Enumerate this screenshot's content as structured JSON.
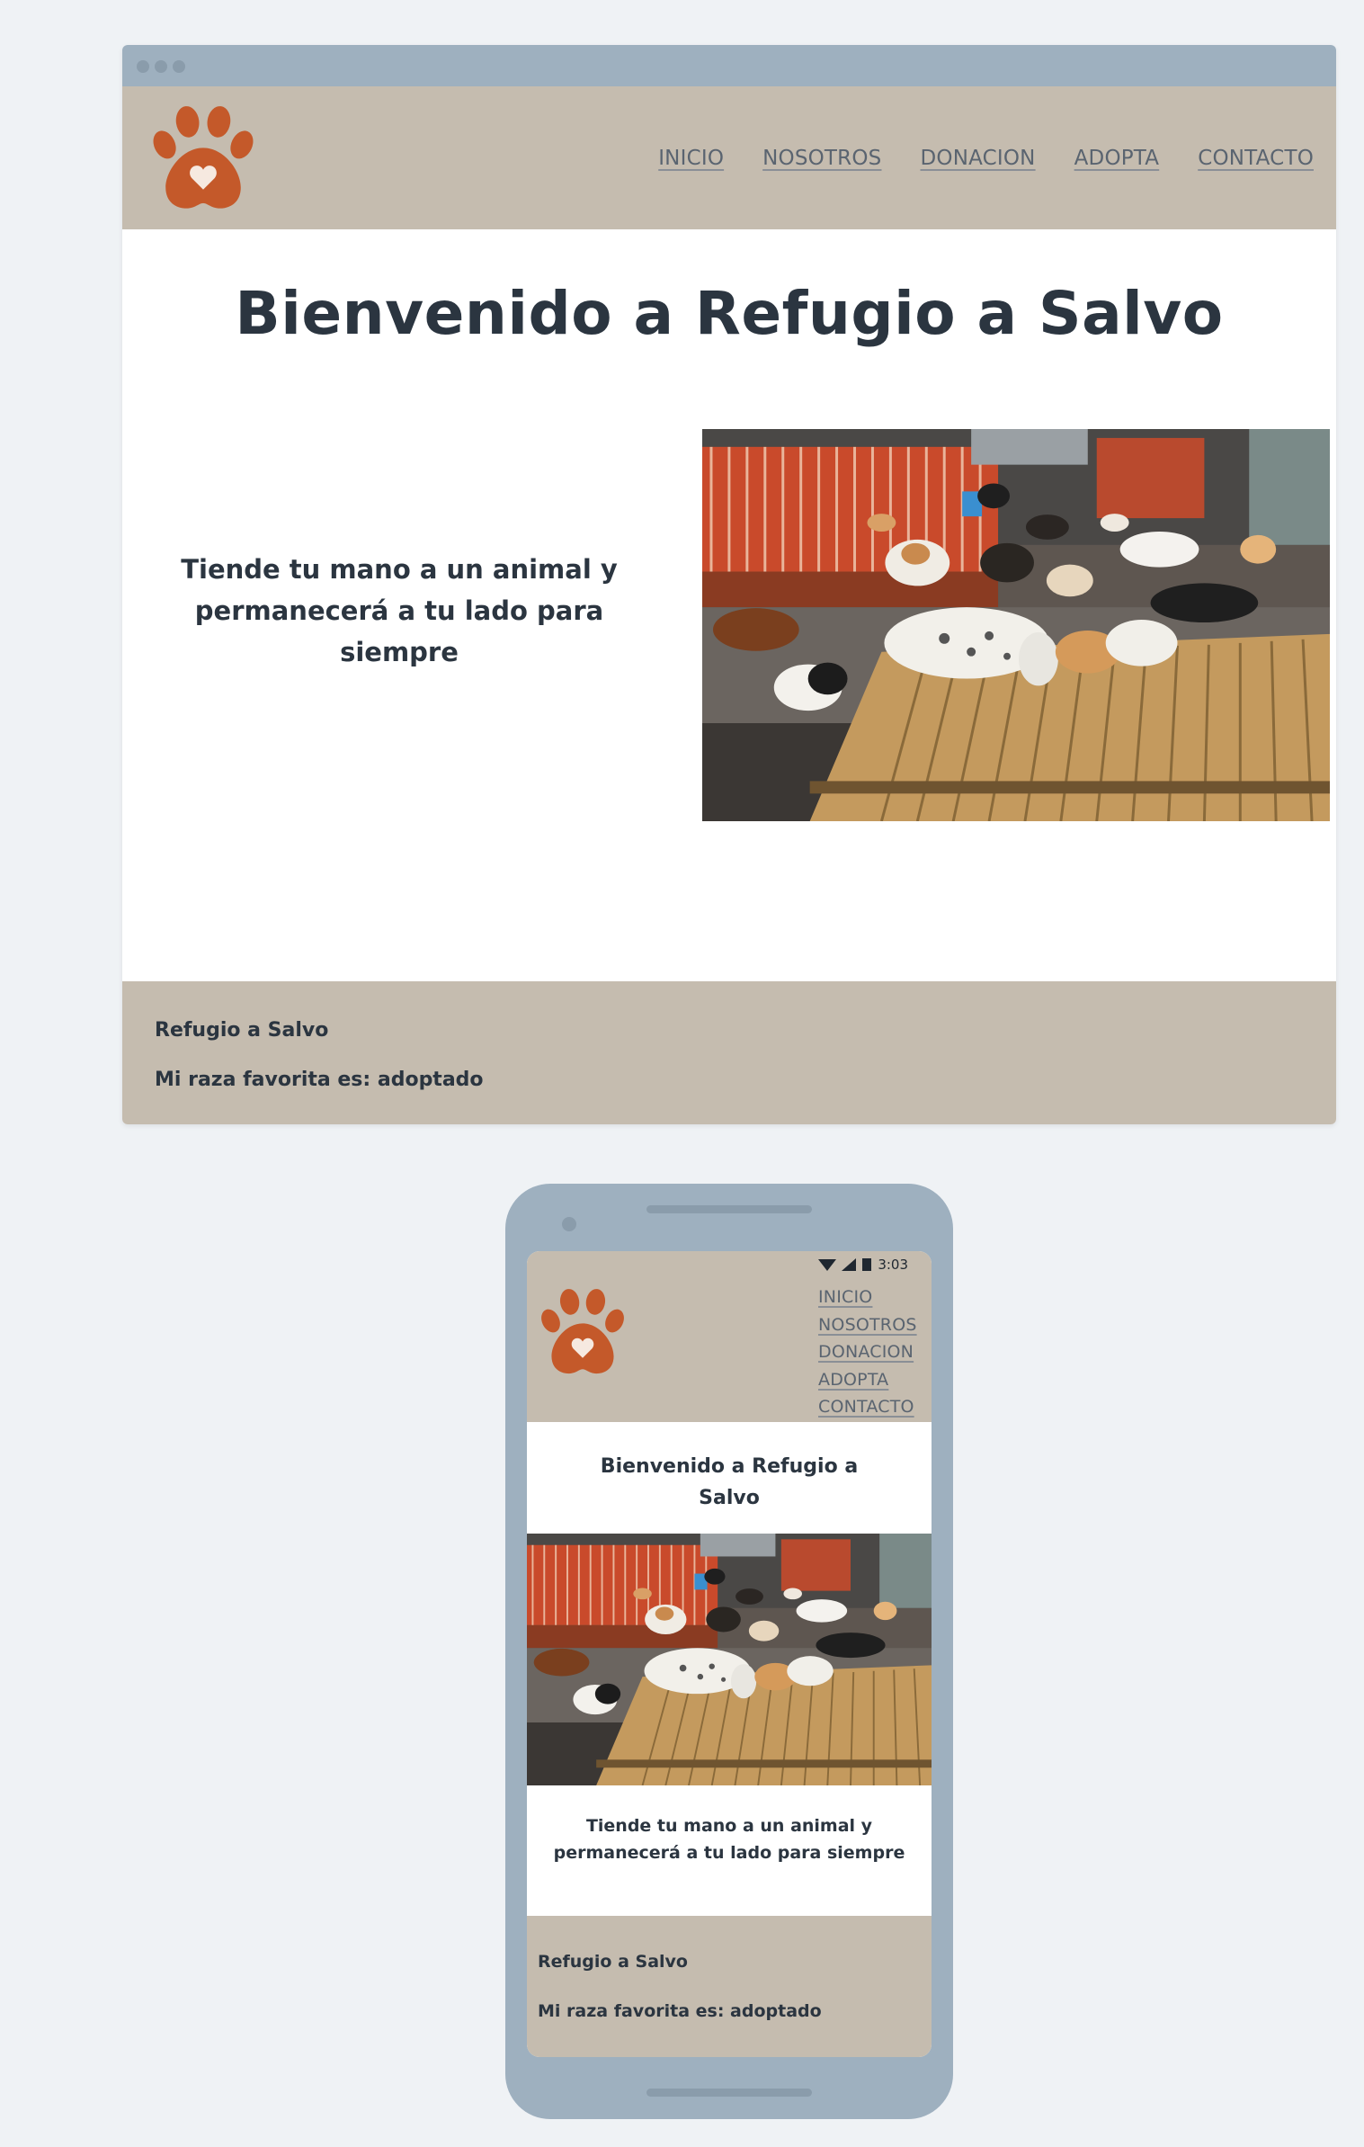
{
  "brand": {
    "logo_icon": "paw-heart-icon",
    "logo_color": "#c4592a",
    "header_bg": "#c5bcaf",
    "text_color": "#2b3540"
  },
  "nav": {
    "items": [
      {
        "label": "INICIO"
      },
      {
        "label": "NOSOTROS"
      },
      {
        "label": "DONACION"
      },
      {
        "label": "ADOPTA"
      },
      {
        "label": "CONTACTO"
      }
    ]
  },
  "hero": {
    "title": "Bienvenido a Refugio a Salvo",
    "tagline": "Tiende tu mano a un animal y permanecerá a tu lado para siempre",
    "image_icon": "shelter-dogs-photo"
  },
  "footer": {
    "name": "Refugio a Salvo",
    "slogan": "Mi raza favorita es: adoptado"
  },
  "mobile": {
    "status_time": "3:03",
    "status_icons": [
      "wifi-icon",
      "signal-icon",
      "battery-icon"
    ]
  }
}
